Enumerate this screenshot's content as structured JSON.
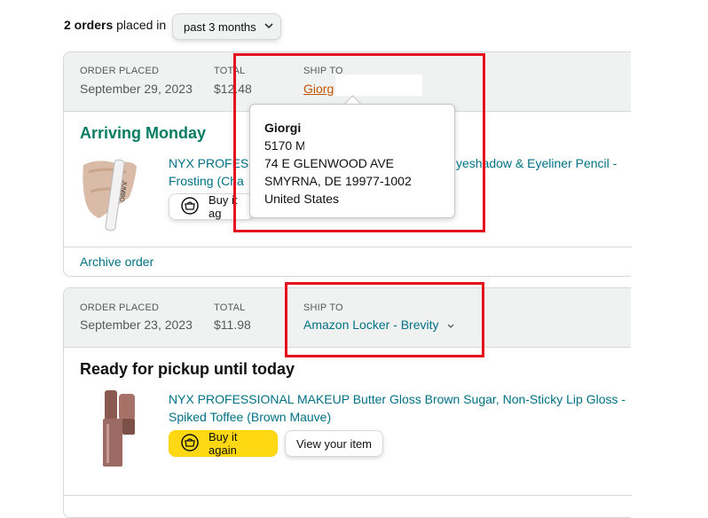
{
  "header": {
    "orders_count": "2 orders",
    "placed_in": "placed in",
    "range_value": "past 3 months"
  },
  "orders": [
    {
      "order_placed_label": "ORDER PLACED",
      "order_placed_value": "September 29, 2023",
      "total_label": "TOTAL",
      "total_value": "$12.48",
      "ship_to_label": "SHIP TO",
      "ship_to_value": "Giorg",
      "status": "Arriving Monday",
      "product_title_line1": "NYX PROFESS",
      "product_title_line1_tail": "yeshadow & Eyeliner Pencil -",
      "product_title_line2": "Frosting (Cha",
      "buy_again_label": "Buy it ag",
      "archive_label": "Archive order",
      "thumb_text": "JUMBO"
    },
    {
      "order_placed_label": "ORDER PLACED",
      "order_placed_value": "September 23, 2023",
      "total_label": "TOTAL",
      "total_value": "$11.98",
      "ship_to_label": "SHIP TO",
      "ship_to_value": "Amazon Locker - Brevity",
      "status": "Ready for pickup until today",
      "product_title_line1": "NYX PROFESSIONAL MAKEUP Butter Gloss Brown Sugar, Non-Sticky Lip Gloss -",
      "product_title_line2": "Spiked Toffee (Brown Mauve)",
      "buy_again_label": "Buy it again",
      "view_item_label": "View your item"
    }
  ],
  "address_popover": {
    "name": "Giorgi",
    "line1": "5170 M",
    "line2": "74 E GLENWOOD AVE",
    "line3": "SMYRNA, DE 19977-1002",
    "country": "United States"
  },
  "icons": {
    "buy_again": "buy-again-icon",
    "chevron": "chevron-down-icon"
  },
  "colors": {
    "link": "#007185",
    "arriving": "#067d62",
    "buy_button": "#ffd814",
    "highlight_box": "#e5111f",
    "header_bg": "#f0f2f2"
  }
}
